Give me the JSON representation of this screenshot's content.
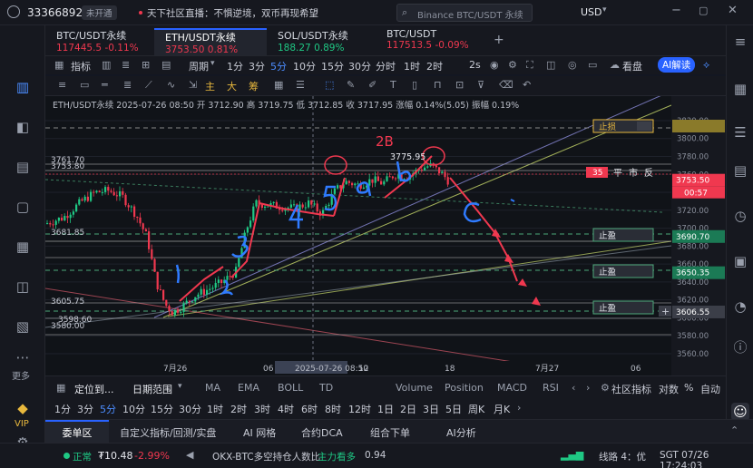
{
  "topbar": {
    "user_id": "33366892",
    "account_badge": "未开通",
    "news_text": "天下社区直播：不惧逆境，双币再现希望",
    "search_placeholder": "Binance BTC/USDT 永续",
    "currency": "USD"
  },
  "tabs": [
    {
      "name": "BTC/USDT永续",
      "price": "117445.5",
      "change": "-0.11%",
      "dir": "down"
    },
    {
      "name": "ETH/USDT永续",
      "price": "3753.50",
      "change": "0.81%",
      "dir": "down"
    },
    {
      "name": "SOL/USDT永续",
      "price": "188.27",
      "change": "0.89%",
      "dir": "up"
    },
    {
      "name": "BTC/USDT",
      "price": "117513.5",
      "change": "-0.09%",
      "dir": "down"
    }
  ],
  "toolbar": {
    "indicator": "指标",
    "period": "周期",
    "intervals": [
      "1分",
      "3分",
      "5分",
      "10分",
      "15分",
      "30分",
      "分时",
      "1时",
      "2时"
    ],
    "active_interval": "5分",
    "speed": "2s",
    "view": "看盘",
    "ai": "AI解读"
  },
  "drawbar": {
    "labels": [
      "主",
      "大",
      "筹"
    ]
  },
  "chart": {
    "header": "ETH/USDT永续 2025-07-26 08:50 开 3712.90 高 3719.75 低 3712.85 收 3717.95 涨幅 0.14%(5.05) 振幅 0.19%",
    "annotation_2b": "2B",
    "price_label": "3775.95",
    "labels_left": [
      "3761.70",
      "3753.80",
      "3681.85",
      "3605.75",
      "3598.60",
      "3580.00"
    ],
    "stop_loss": "止损",
    "take_profit": "止盈",
    "order_tag": "35",
    "order_labels": [
      "平",
      "市",
      "反"
    ],
    "countdown": "00:57",
    "current_price": "3753.50",
    "price_axis": [
      "3820.00",
      "3800.00",
      "3780.00",
      "3760.00",
      "3740.00",
      "3720.00",
      "3700.00",
      "3680.00",
      "3660.00",
      "3640.00",
      "3620.00",
      "3600.00",
      "3580.00",
      "3560.00"
    ],
    "marked_prices": [
      "3690.70",
      "3650.35",
      "3606.55"
    ],
    "time_axis": [
      "7月26",
      "06",
      "2025-07-26 08:50",
      "12",
      "18",
      "7月27",
      "06"
    ],
    "wave_labels": [
      "1",
      "2",
      "3",
      "4",
      "5",
      "a",
      "b",
      "c"
    ],
    "colors": {
      "up": "#1fc884",
      "down": "#f0384f",
      "accent": "#2962ff"
    }
  },
  "indicator_bar": {
    "positioning": "定位到...",
    "date_range": "日期范围",
    "items_left": [
      "MA",
      "EMA",
      "BOLL",
      "TD"
    ],
    "items_right": [
      "Volume",
      "Position",
      "MACD",
      "RSI"
    ],
    "community": "社区指标",
    "log": "对数",
    "percent": "%",
    "auto": "自动"
  },
  "period_bar": {
    "items": [
      "1分",
      "3分",
      "5分",
      "10分",
      "15分",
      "30分",
      "1时",
      "2时",
      "3时",
      "4时",
      "6时",
      "8时",
      "12时",
      "1日",
      "2日",
      "3日",
      "5日",
      "周K",
      "月K"
    ],
    "active": "5分"
  },
  "bottom_tabs": {
    "items": [
      "委单区",
      "自定义指标/回测/实盘",
      "AI 网格",
      "合约DCA",
      "组合下单",
      "AI分析"
    ],
    "active": "委单区"
  },
  "status": {
    "state": "正常",
    "balance": "₮10.48",
    "balance_change": "-2.99%",
    "ticker_text": "OKX-BTC多空持仓人数比",
    "ticker_tag": "主力看多",
    "ticker_value": "0.94",
    "line": "线路 4：优",
    "time": "SGT 07/26 17:24:03"
  },
  "sidebar": {
    "more": "更多",
    "vip": "VIP"
  }
}
